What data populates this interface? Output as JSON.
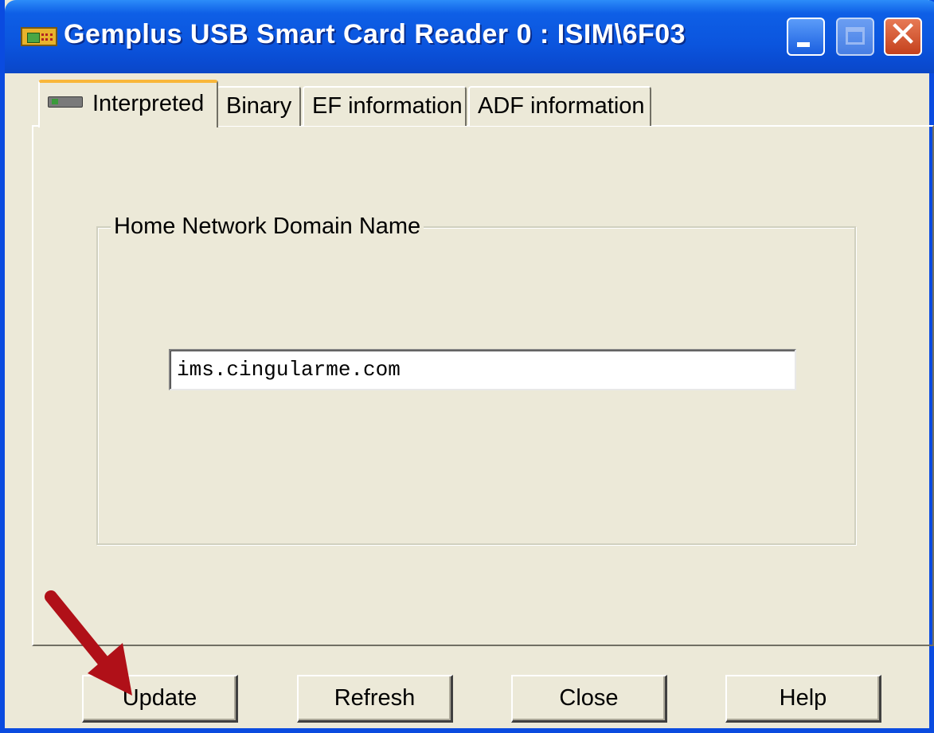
{
  "window": {
    "title": "Gemplus USB Smart Card Reader 0 : ISIM\\6F03"
  },
  "tabs": [
    {
      "label": "Interpreted",
      "active": true
    },
    {
      "label": "Binary",
      "active": false
    },
    {
      "label": "EF information",
      "active": false
    },
    {
      "label": "ADF information",
      "active": false
    }
  ],
  "group": {
    "label": "Home Network Domain Name",
    "field_value": "ims.cingularme.com"
  },
  "buttons": {
    "update": "Update",
    "refresh": "Refresh",
    "close": "Close",
    "help": "Help"
  },
  "colors": {
    "titlebar": "#0a55de",
    "dialog_background": "#ece9d8",
    "annotation_arrow": "#b01018"
  },
  "icons": {
    "app": "smart-card-icon",
    "tab": "card-reader-icon",
    "annotation": "red-arrow-icon"
  }
}
